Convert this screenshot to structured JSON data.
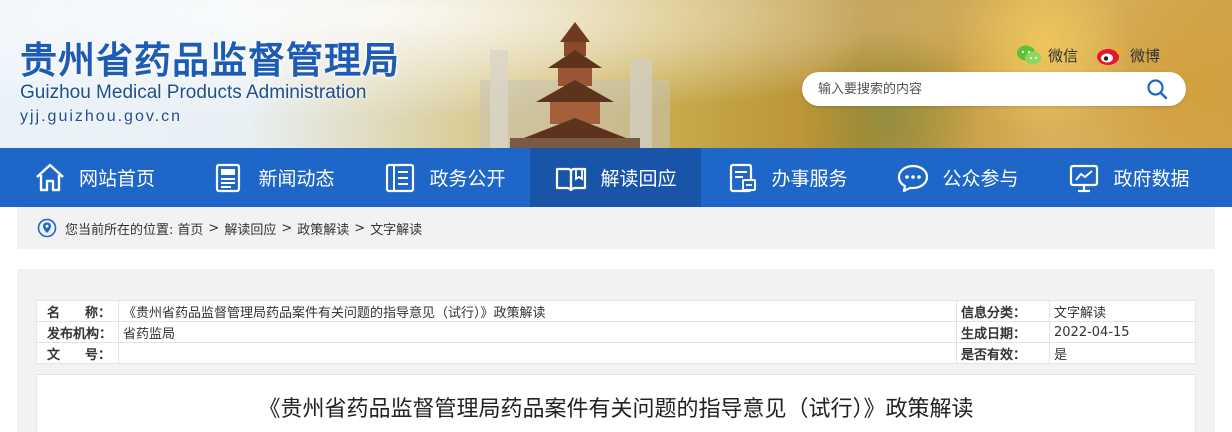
{
  "header": {
    "title_cn": "贵州省药品监督管理局",
    "title_en": "Guizhou Medical Products Administration",
    "url": "yjj.guizhou.gov.cn",
    "wechat_label": "微信",
    "weibo_label": "微博",
    "search_placeholder": "输入要搜索的内容"
  },
  "nav": {
    "items": [
      {
        "label": "网站首页",
        "icon": "home-icon"
      },
      {
        "label": "新闻动态",
        "icon": "news-icon"
      },
      {
        "label": "政务公开",
        "icon": "document-icon"
      },
      {
        "label": "解读回应",
        "icon": "book-icon"
      },
      {
        "label": "办事服务",
        "icon": "service-icon"
      },
      {
        "label": "公众参与",
        "icon": "chat-icon"
      },
      {
        "label": "政府数据",
        "icon": "data-icon"
      }
    ],
    "active_index": 3
  },
  "breadcrumb": {
    "prefix": "您当前所在的位置:",
    "items": [
      "首页",
      "解读回应",
      "政策解读",
      "文字解读"
    ]
  },
  "meta": {
    "name_label_1": "名",
    "name_label_2": "称：",
    "name_value": "《贵州省药品监督管理局药品案件有关问题的指导意见（试行）》政策解读",
    "category_label": "信息分类：",
    "category_value": "文字解读",
    "publisher_label": "发布机构：",
    "publisher_value": "省药监局",
    "date_label": "生成日期：",
    "date_value": "2022-04-15",
    "docno_label_1": "文",
    "docno_label_2": "号：",
    "docno_value": "",
    "valid_label": "是否有效：",
    "valid_value": "是"
  },
  "article": {
    "title": "《贵州省药品监督管理局药品案件有关问题的指导意见（试行）》政策解读"
  },
  "colors": {
    "nav_bg": "#1e66c7",
    "nav_active": "#1855a8",
    "title_blue": "#1d5bb5"
  }
}
